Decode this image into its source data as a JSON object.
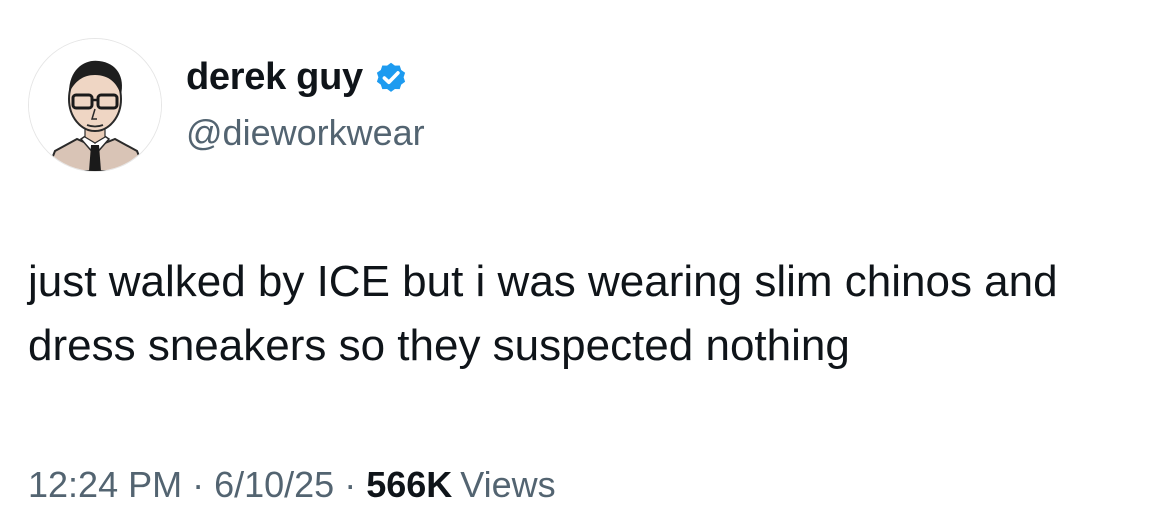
{
  "author": {
    "display_name": "derek guy",
    "handle": "@dieworkwear",
    "verified_icon": "verified-badge-icon",
    "avatar": "portrait-illustration"
  },
  "tweet": {
    "text": "just walked by ICE but i was wearing slim chinos and dress sneakers so they suspected nothing"
  },
  "meta": {
    "time": "12:24 PM",
    "separator": "·",
    "date": "6/10/25",
    "views_count": "566K",
    "views_label": "Views"
  },
  "colors": {
    "primary_text": "#0f1419",
    "secondary_text": "#536471",
    "verified_blue": "#1d9bf0"
  }
}
